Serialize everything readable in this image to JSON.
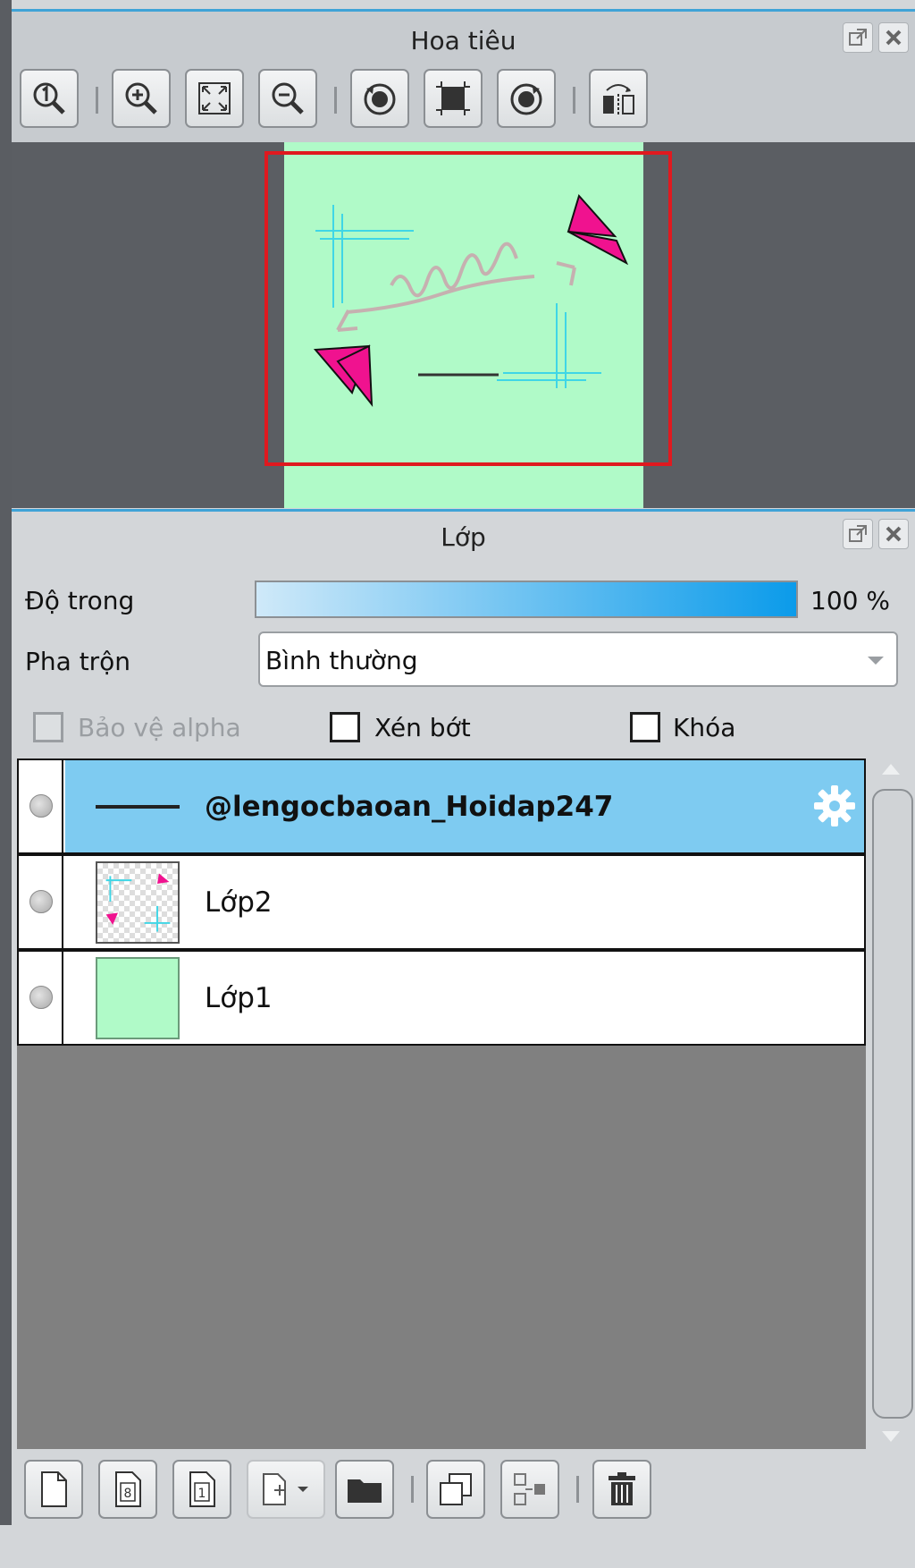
{
  "navigator": {
    "title": "Hoa tiêu",
    "tools": [
      "zoom-actual-size-icon",
      "zoom-in-icon",
      "fit-screen-icon",
      "zoom-out-icon",
      "rotate-left-icon",
      "reset-rotation-icon",
      "rotate-right-icon",
      "flip-horizontal-icon"
    ],
    "frame_color": "#e0191f",
    "canvas_color": "#b0fac8"
  },
  "layers": {
    "title": "Lớp",
    "opacity_label": "Độ trong",
    "opacity_value": "100 %",
    "opacity": 1.0,
    "blend_label": "Pha trộn",
    "blend_value": "Bình thường",
    "protect_alpha_label": "Bảo vệ alpha",
    "clipping_label": "Xén bớt",
    "lock_label": "Khóa",
    "items": [
      {
        "name": "@lengocbaoan_Hoidap247",
        "selected": true,
        "type": "text"
      },
      {
        "name": "Lớp2",
        "selected": false,
        "type": "transparent"
      },
      {
        "name": "Lớp1",
        "selected": false,
        "type": "filled"
      }
    ],
    "bottom_tools": [
      "new-layer-icon",
      "new-8bit-layer-icon",
      "new-1bit-layer-icon",
      "add-layer-menu-icon",
      "new-folder-icon",
      "duplicate-layer-icon",
      "merge-down-icon",
      "delete-layer-icon"
    ]
  },
  "colors": {
    "accent": "#3fa3d7",
    "selected_row": "#7ecbf1",
    "thumb_green": "#b0fac8",
    "pink": "#f0128f",
    "cyan": "#3fd6e6"
  }
}
